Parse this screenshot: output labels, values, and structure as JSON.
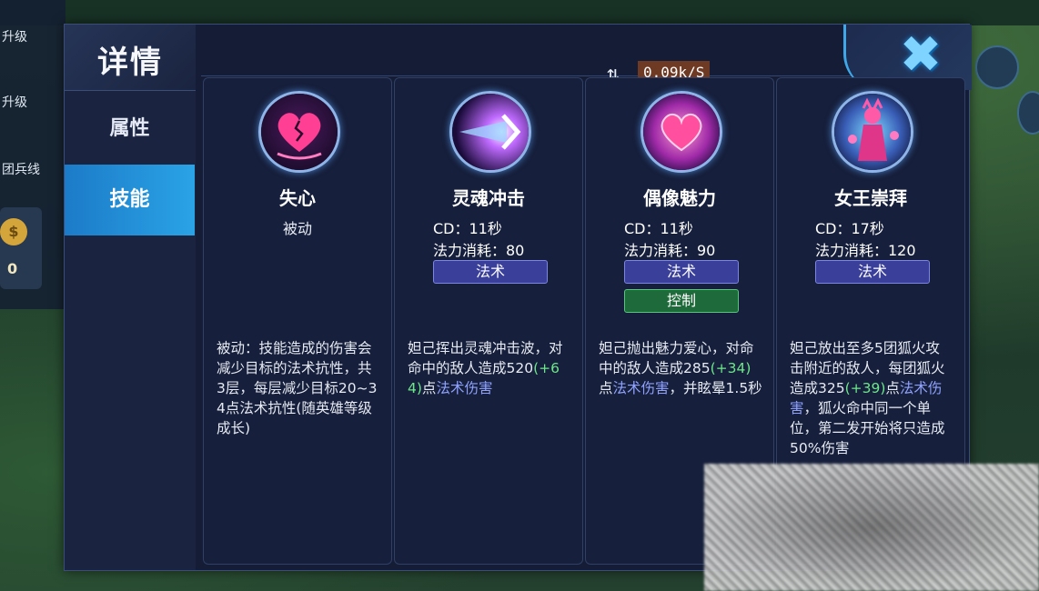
{
  "background": {
    "left_rows": [
      "升级",
      "升级",
      "团兵线"
    ],
    "coin_icon": "$",
    "coin_value": "0"
  },
  "panel": {
    "title": "详情",
    "tabs": [
      {
        "label": "属性",
        "active": false
      },
      {
        "label": "技能",
        "active": true
      }
    ],
    "close_icon": "close-x",
    "accent_color": "#2aa3e6"
  },
  "netspeed": {
    "icon": "sync-icon",
    "value": "0.09k/S"
  },
  "skills": [
    {
      "name": "失心",
      "type": "被动",
      "icon": "broken-heart-icon",
      "desc_parts": [
        {
          "t": "被动：技能造成的伤害会减少目标的法术抗性，共3层，每层减少目标20~34点法术抗性(随英雄等级成长)",
          "c": ""
        }
      ]
    },
    {
      "name": "灵魂冲击",
      "cd": "CD：11秒",
      "mana": "法力消耗：80",
      "tags": [
        "法术"
      ],
      "icon": "soul-blast-icon",
      "desc_parts": [
        {
          "t": "妲己挥出灵魂冲击波，对命中的敌人造成520",
          "c": ""
        },
        {
          "t": "(+64)",
          "c": "green"
        },
        {
          "t": "点",
          "c": ""
        },
        {
          "t": "法术伤害",
          "c": "blue"
        }
      ]
    },
    {
      "name": "偶像魅力",
      "cd": "CD：11秒",
      "mana": "法力消耗：90",
      "tags": [
        "法术"
      ],
      "control_tag": "控制",
      "icon": "charm-heart-icon",
      "desc_parts": [
        {
          "t": "妲己抛出魅力爱心，对命中的敌人造成285",
          "c": ""
        },
        {
          "t": "(+34)",
          "c": "green"
        },
        {
          "t": "点",
          "c": ""
        },
        {
          "t": "法术伤害",
          "c": "blue"
        },
        {
          "t": "，并眩晕1.5秒",
          "c": ""
        }
      ]
    },
    {
      "name": "女王崇拜",
      "cd": "CD：17秒",
      "mana": "法力消耗：120",
      "tags": [
        "法术"
      ],
      "icon": "queen-worship-icon",
      "desc_parts": [
        {
          "t": "妲己放出至多5团狐火攻击附近的敌人，每团狐火造成325",
          "c": ""
        },
        {
          "t": "(+39)",
          "c": "green"
        },
        {
          "t": "点",
          "c": ""
        },
        {
          "t": "法术伤害",
          "c": "blue"
        },
        {
          "t": "，狐火命中同一个单位，第二发开始将只造成50%伤害",
          "c": ""
        }
      ]
    }
  ]
}
